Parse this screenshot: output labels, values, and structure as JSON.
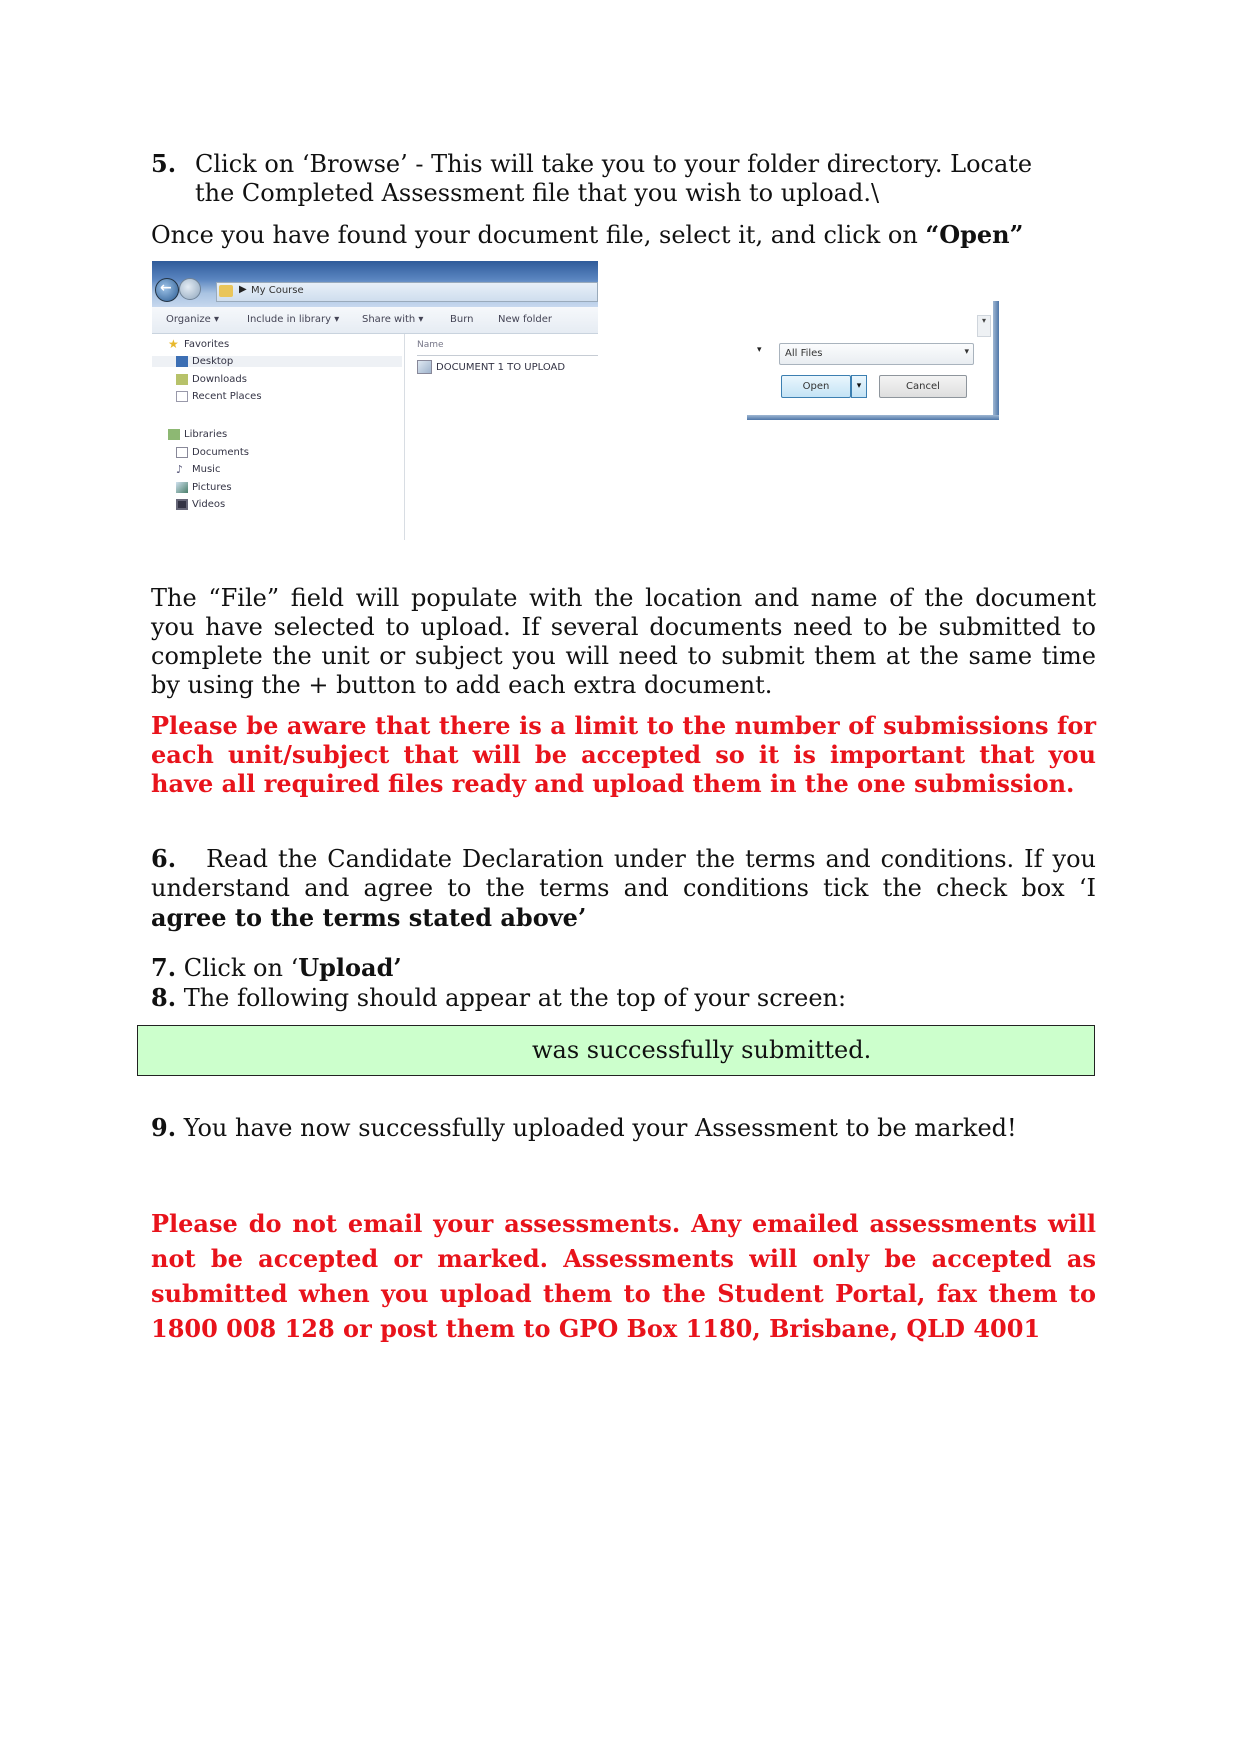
{
  "step5": {
    "number": "5.",
    "text_line1": "Click on ‘Browse’ - This will take you to your folder directory. Locate",
    "text_line2": "the Completed Assessment file that you wish to upload.\\"
  },
  "once_found": {
    "text": "Once you have found your document file, select it, and click on ",
    "bold": "“Open”"
  },
  "explorer_screenshot": {
    "address_path": "My Course",
    "toolbar": [
      "Organize ▾",
      "Include in library ▾",
      "Share with ▾",
      "Burn",
      "New folder"
    ],
    "nav_items": [
      {
        "label": "Favorites",
        "icon": "star-icon"
      },
      {
        "label": "Desktop",
        "icon": "desktop-icon"
      },
      {
        "label": "Downloads",
        "icon": "downloads-icon"
      },
      {
        "label": "Recent Places",
        "icon": "recent-places-icon"
      },
      {
        "label": "Libraries",
        "icon": "libraries-icon"
      },
      {
        "label": "Documents",
        "icon": "documents-icon"
      },
      {
        "label": "Music",
        "icon": "music-icon"
      },
      {
        "label": "Pictures",
        "icon": "pictures-icon"
      },
      {
        "label": "Videos",
        "icon": "videos-icon"
      }
    ],
    "column_header": "Name",
    "files": [
      "DOCUMENT 1 TO UPLOAD"
    ]
  },
  "open_dialog": {
    "filetype": "All Files",
    "open_label": "Open",
    "cancel_label": "Cancel"
  },
  "file_field_para": "The “File” field will populate with the location and name of the document you have selected to upload. If several documents need to be submitted to complete the unit or subject you will need to submit them at the same time by using the + button to add each extra document.",
  "warning1": "Please be aware that there is a limit to the number of submissions for each unit/subject that will be accepted so it is important that you have all required files ready and upload them in the one submission.",
  "step6": {
    "number": "6.",
    "text": "Read the Candidate Declaration under the terms and conditions. If you understand and agree to the terms and conditions tick the check box ‘I ",
    "bold": "agree to the terms stated above’"
  },
  "step7": {
    "number": "7.",
    "text": "Click on ‘",
    "bold": "Upload’"
  },
  "step8": {
    "number": "8.",
    "text": " The following should appear at the top of your screen:"
  },
  "success_message": "was successfully submitted.",
  "step9": {
    "number": "9.",
    "text": " You have now successfully uploaded your Assessment to be marked!"
  },
  "warning2": "Please do not email your assessments. Any emailed assessments will not be accepted or marked. Assessments will only be accepted as submitted when you upload them to the Student Portal, fax them to 1800 008 128 or post them to GPO Box 1180, Brisbane, QLD 4001",
  "colors": {
    "warning_red": "#e8131b",
    "success_bg": "#ccffcc"
  }
}
